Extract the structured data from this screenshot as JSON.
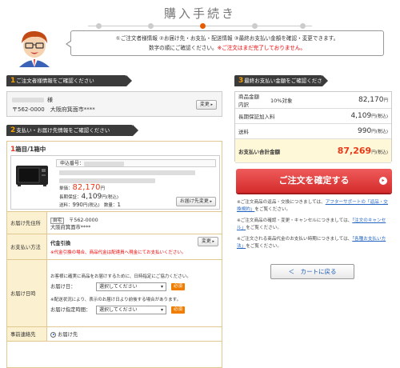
{
  "page": {
    "title": "購入手続き"
  },
  "notice": {
    "line1": "①ご注文者様情報 ②お届け先・お支払・配送情報 ③最終お支払い金額を確認・変更できます。",
    "line2_text": "数字の順にご確認ください。",
    "line2_warn": "※ご注文はまだ完了しておりません。"
  },
  "sections": {
    "s1": {
      "num": "1",
      "title": "ご注文者様情報をご確認ください"
    },
    "s2": {
      "num": "2",
      "title": "支払い・お届け先情報をご確認ください"
    },
    "s3": {
      "num": "3",
      "title": "最終お支払い金額をご確認ください"
    }
  },
  "orderer": {
    "name_suffix": "様",
    "postal": "〒562-0000",
    "address": "大阪府箕面市****",
    "change_label": "変更"
  },
  "shipment": {
    "num": "1",
    "label": "箱目/1箱中",
    "order_no_label": "申込番号：",
    "unit_price_label": "単価：",
    "unit_price": "82,170",
    "unit_price_unit": "円",
    "warranty_label": "長期保証：",
    "warranty_price": "4,109",
    "warranty_unit": "円(税込)",
    "shipping_label": "送料：",
    "shipping_price": "990",
    "shipping_unit": "円(税込)",
    "qty_label": "数量：",
    "qty": "1",
    "change_dest_label": "お届け先変更"
  },
  "ship_table": {
    "dest_label": "お届け先住所",
    "home_badge": "自宅",
    "postal": "〒562-0000",
    "address": "大阪府箕面市****",
    "pay_label": "お支払い方法",
    "pay_method": "代金引換",
    "pay_note": "※代金引換の場合、商品代金は配達員へ現金にてお支払いください。",
    "pay_change": "変更",
    "date_label": "お届け日時",
    "date_note": "お客様に確実に商品をお届けするために、日時指定にご協力ください。",
    "date_field_label": "お届け日：",
    "select_placeholder": "選択してください",
    "required_label": "必須",
    "delay_note": "※配送状況により、表示のお届け日より前後する場合があります。",
    "time_field_label": "お届け指定時間：",
    "contact_label": "事前連絡先",
    "contact_option": "お届け先"
  },
  "summary": {
    "rows": [
      {
        "label": "商品金額内訳",
        "badge": "10%対象",
        "value": "82,170",
        "unit": "円"
      },
      {
        "label": "長期保証加入料",
        "badge": "",
        "value": "4,109",
        "unit": "円(税込)"
      },
      {
        "label": "送料",
        "badge": "",
        "value": "990",
        "unit": "円(税込)"
      }
    ],
    "total_label": "お支払い合計金額",
    "total_value": "87,269",
    "total_unit": "円(税込)"
  },
  "confirm": {
    "label": "ご注文を確定する",
    "arrow": "▸"
  },
  "notes": {
    "n1_a": "※ご注文商品の返品・交換につきましては、",
    "n1_link": "アフターサポートの「返品・交換規約」",
    "n1_b": "をご覧ください。",
    "n2_a": "※ご注文商品の確認・変更・キャンセルにつきましては、",
    "n2_link": "「注文のキャンセル」",
    "n2_b": "をご覧ください。",
    "n3_a": "※ご注文される商品代金のお支払い時期につきましては、",
    "n3_link": "「各種お支払い方法」",
    "n3_b": "をご覧ください。"
  },
  "back": {
    "label": "＜　カートに戻る"
  }
}
